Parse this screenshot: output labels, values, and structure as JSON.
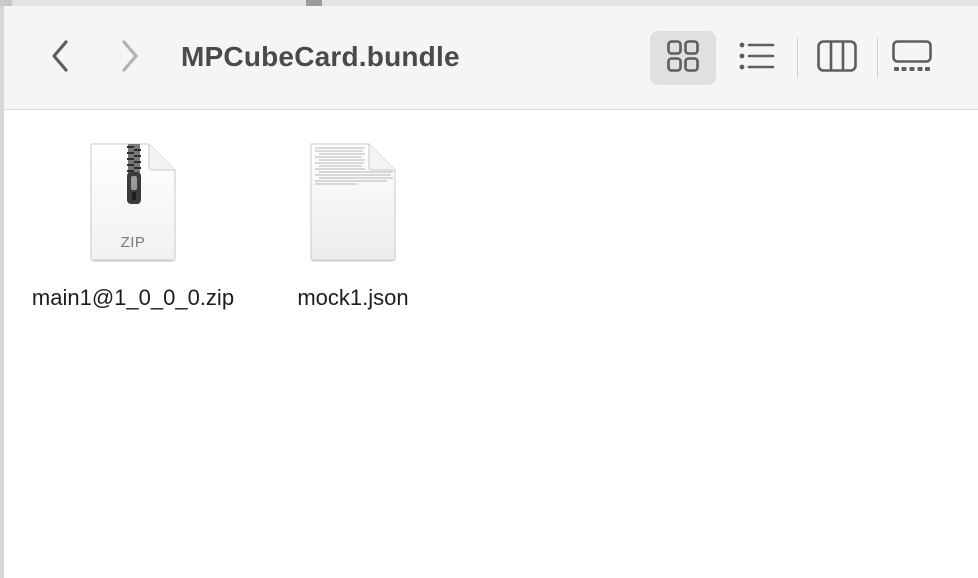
{
  "window": {
    "title": "MPCubeCard.bundle"
  },
  "toolbar": {
    "back_icon": "chevron-left-icon",
    "forward_icon": "chevron-right-icon",
    "views": [
      {
        "name": "icon-view",
        "icon": "grid-icon",
        "selected": true
      },
      {
        "name": "list-view",
        "icon": "list-icon",
        "selected": false
      },
      {
        "name": "column-view",
        "icon": "columns-icon",
        "selected": false
      },
      {
        "name": "gallery-view",
        "icon": "gallery-icon",
        "selected": false
      }
    ]
  },
  "files": [
    {
      "name": "main1@1_0_0_0.zip",
      "icon": "zip-archive-icon",
      "badge": "ZIP"
    },
    {
      "name": "mock1.json",
      "icon": "json-document-icon"
    }
  ],
  "colors": {
    "toolbar_bg": "#f6f4f6",
    "selected_view_bg": "#e1dfe1",
    "title_text": "#4a4a4a",
    "icon_gray": "#5e5e5e"
  }
}
